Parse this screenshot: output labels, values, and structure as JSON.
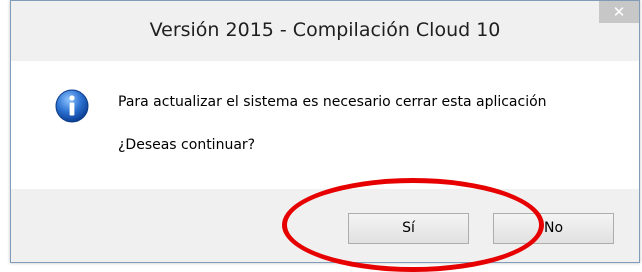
{
  "window": {
    "title": "Versión  2015 - Compilación Cloud 10",
    "close_symbol": "✕"
  },
  "message": {
    "icon": "info-icon",
    "line1": "Para actualizar el sistema es necesario cerrar esta aplicación",
    "line2": "¿Deseas continuar?"
  },
  "buttons": {
    "yes_label": "Sí",
    "no_label": "No"
  },
  "annotation": {
    "shape": "ellipse",
    "color": "#e60000",
    "target": "Sí"
  },
  "colors": {
    "dialog_bg": "#f0f0f0",
    "content_bg": "#ffffff",
    "icon_blue": "#1f5fbf"
  }
}
